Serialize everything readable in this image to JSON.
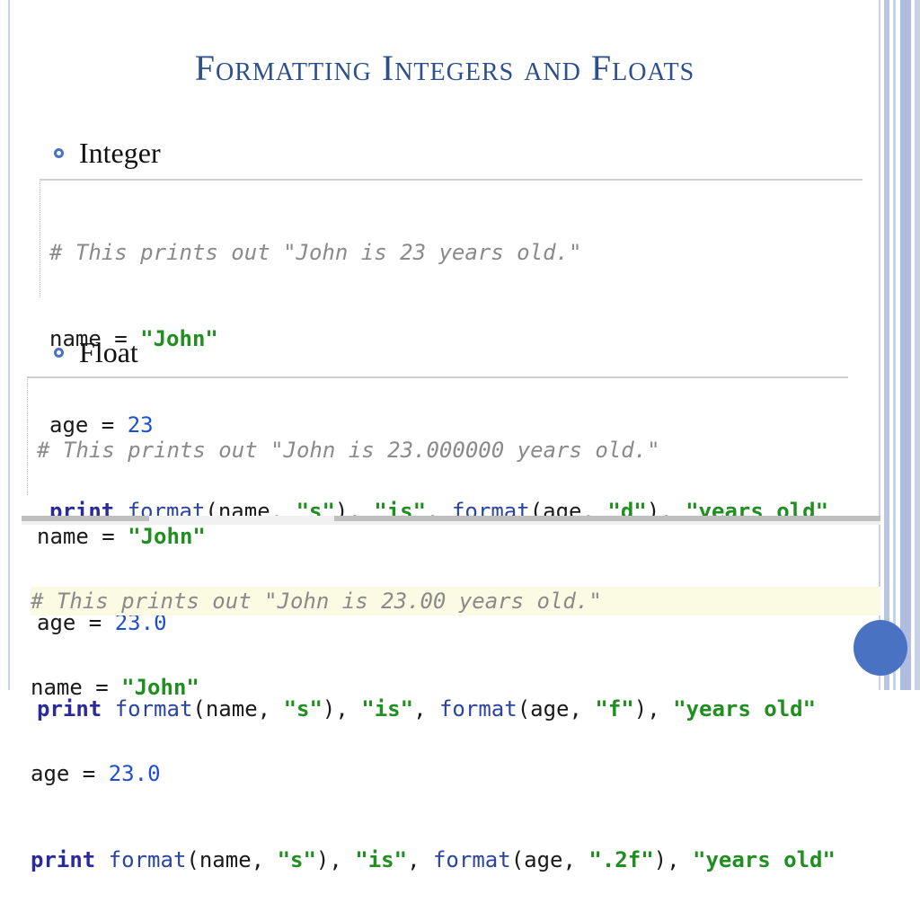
{
  "slide": {
    "title": "Formatting Integers and Floats",
    "bullets": [
      "Integer",
      "Float"
    ]
  },
  "code_blocks": [
    {
      "comment": "# This prints out \"John is 23 years old.\"",
      "name_line": {
        "var": "name",
        "op": " = ",
        "value": "\"John\""
      },
      "age_line": {
        "var": "age",
        "op": " = ",
        "value": "23"
      },
      "print_line": {
        "kw": "print",
        "fn1": "format",
        "p1": "(name, ",
        "s1": "\"s\"",
        "p2": "), ",
        "s2": "\"is\"",
        "p3": ", ",
        "fn2": "format",
        "p4": "(age, ",
        "s3": "\"d\"",
        "p5": "), ",
        "s4": "\"years old\""
      }
    },
    {
      "comment": "# This prints out \"John is 23.000000 years old.\"",
      "name_line": {
        "var": "name",
        "op": " = ",
        "value": "\"John\""
      },
      "age_line": {
        "var": "age",
        "op": " = ",
        "value": "23.0"
      },
      "print_line": {
        "kw": "print",
        "fn1": "format",
        "p1": "(name, ",
        "s1": "\"s\"",
        "p2": "), ",
        "s2": "\"is\"",
        "p3": ", ",
        "fn2": "format",
        "p4": "(age, ",
        "s3": "\"f\"",
        "p5": "), ",
        "s4": "\"years old\""
      }
    },
    {
      "comment": "# This prints out \"John is 23.00 years old.\"",
      "name_line": {
        "var": "name",
        "op": " = ",
        "value": "\"John\""
      },
      "age_line": {
        "var": "age",
        "op": " = ",
        "value": "23.0"
      },
      "print_line": {
        "kw": "print",
        "fn1": "format",
        "p1": "(name, ",
        "s1": "\"s\"",
        "p2": "), ",
        "s2": "\"is\"",
        "p3": ", ",
        "fn2": "format",
        "p4": "(age, ",
        "s3": "\".2f\"",
        "p5": "), ",
        "s4": "\"years old\""
      }
    }
  ],
  "colors": {
    "title": "#2c4f8e",
    "bullet": "#4a72c2",
    "comment": "#8a8a8a",
    "keyword": "#2a2a9e",
    "string": "#1f8f1f",
    "number": "#1d4fd6"
  }
}
